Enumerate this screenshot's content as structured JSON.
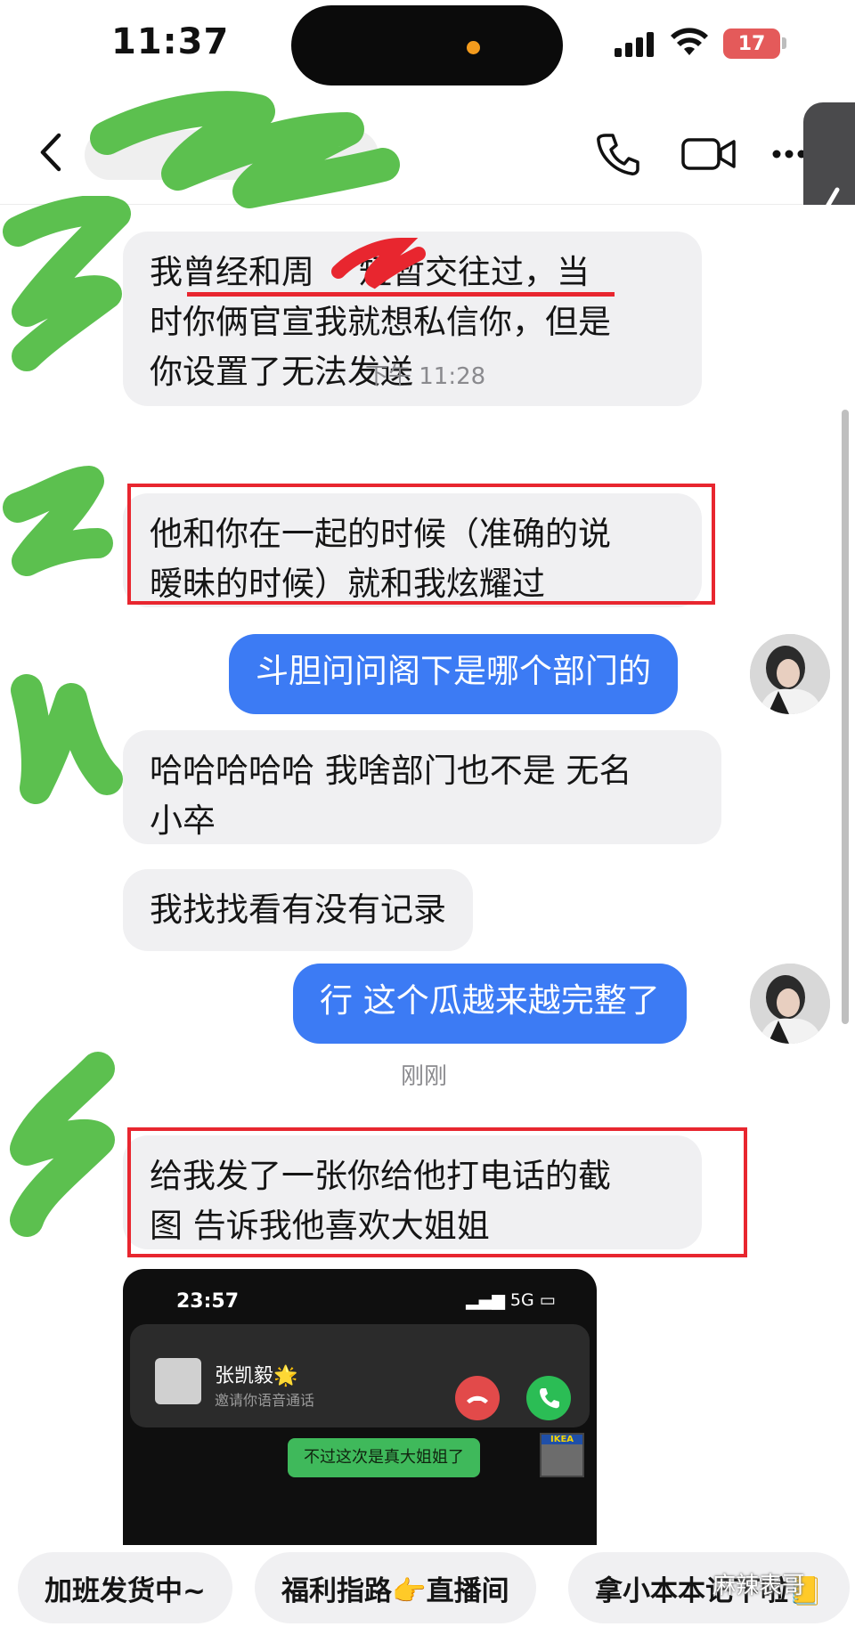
{
  "status_bar": {
    "time": "11:37",
    "battery": "17"
  },
  "messages": [
    {
      "id": "m1",
      "direction": "in",
      "text_lines": [
        "我曾经和周",
        "短暂交往过，当",
        "时你俩官宣我就想私信你，但是",
        "你设置了无法发送"
      ]
    },
    {
      "id": "m2",
      "direction": "in",
      "text_lines": [
        "他和你在一起的时候（准确的说",
        "暧昧的时候）就和我炫耀过"
      ]
    },
    {
      "id": "m3",
      "direction": "out",
      "text": "斗胆问问阁下是哪个部门的"
    },
    {
      "id": "m4",
      "direction": "in",
      "text_lines": [
        "哈哈哈哈哈 我啥部门也不是 无名",
        "小卒"
      ]
    },
    {
      "id": "m5",
      "direction": "in",
      "text": "我找找看有没有记录"
    },
    {
      "id": "m6",
      "direction": "out",
      "text": "行 这个瓜越来越完整了"
    },
    {
      "id": "m7",
      "direction": "in",
      "text_lines": [
        "给我发了一张你给他打电话的截",
        "图 告诉我他喜欢大姐姐"
      ]
    }
  ],
  "timestamps": {
    "t1": "下午 11:28",
    "t2": "刚刚"
  },
  "shared_screenshot": {
    "time": "23:57",
    "network": "5G",
    "caller_name": "张凯毅🌟",
    "caller_sub": "邀请你语音通话",
    "bubble_text": "不过这次是真大姐姐了",
    "thumb_label": "IKEA"
  },
  "quick_chips": [
    "加班发货中~",
    "福利指路👉直播间",
    "拿小本本记下啦📒"
  ],
  "watermark": "麻辣表哥",
  "colors": {
    "outgoing": "#3c7bf4",
    "incoming": "#f0f0f2",
    "highlight": "#e8262f",
    "redaction": "#5cc04f"
  }
}
